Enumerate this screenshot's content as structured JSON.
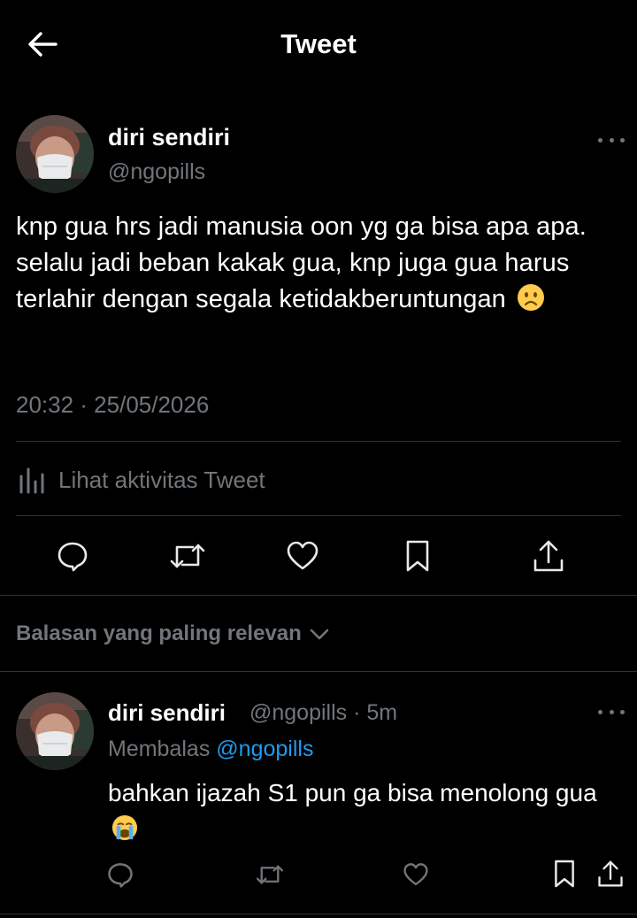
{
  "header": {
    "title": "Tweet"
  },
  "tweet": {
    "author_name": "diri sendiri",
    "author_handle": "@ngopills",
    "text": "knp gua hrs jadi manusia oon yg ga bisa apa apa. selalu jadi beban kakak gua, knp juga gua harus terlahir dengan segala ketidakberuntungan",
    "emoji": "frowning-face",
    "timestamp": "20:32 · 25/05/2026",
    "analytics_label": "Lihat aktivitas Tweet"
  },
  "actions": [
    "reply-icon",
    "retweet-icon",
    "like-icon",
    "bookmark-icon",
    "share-icon"
  ],
  "replies_sort": {
    "label": "Balasan yang paling relevan"
  },
  "reply": {
    "author_name": "diri sendiri",
    "author_handle": "@ngopills · 5m",
    "replying_prefix": "Membalas",
    "replying_to": "@ngopills",
    "text": "bahkan ijazah S1 pun ga bisa menolong gua",
    "emoji": "crying-face"
  },
  "colors": {
    "background": "#000000",
    "text": "#e7e9ea",
    "muted": "#71767b",
    "link": "#1d9bf0",
    "divider": "#2f3336"
  }
}
